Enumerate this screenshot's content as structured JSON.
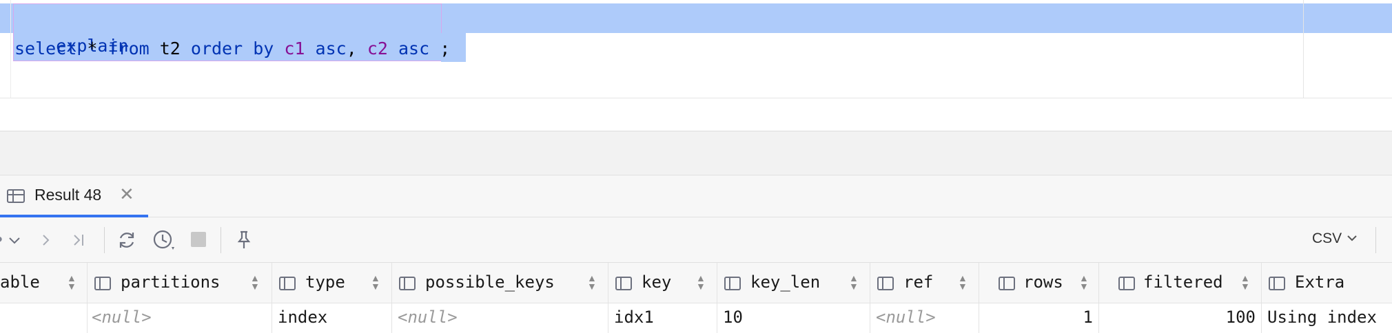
{
  "editor": {
    "line1": {
      "kw": "explain"
    },
    "line2": {
      "select": "select",
      "star": " * ",
      "from": "from",
      "table": " t2 ",
      "order_by": "order by",
      "c1": " c1",
      "asc1": " asc",
      "comma": ", ",
      "c2": "c2",
      "asc2": " asc",
      "semi": " ;"
    }
  },
  "results_tab": {
    "label": "Result 48",
    "close_glyph": "✕"
  },
  "toolbar": {
    "icons": [
      "chevron-down-icon",
      "next-icon",
      "last-icon",
      "refresh-icon",
      "history-icon",
      "stop-icon",
      "pin-icon"
    ],
    "export_label": "CSV"
  },
  "grid": {
    "columns": [
      "able",
      "partitions",
      "type",
      "possible_keys",
      "key",
      "key_len",
      "ref",
      "rows",
      "filtered",
      "Extra"
    ],
    "row": {
      "partitions": "<null>",
      "type": "index",
      "possible_keys": "<null>",
      "key": "idx1",
      "key_len": "10",
      "ref": "<null>",
      "rows": "1",
      "filtered": "100",
      "Extra": "Using index"
    }
  }
}
